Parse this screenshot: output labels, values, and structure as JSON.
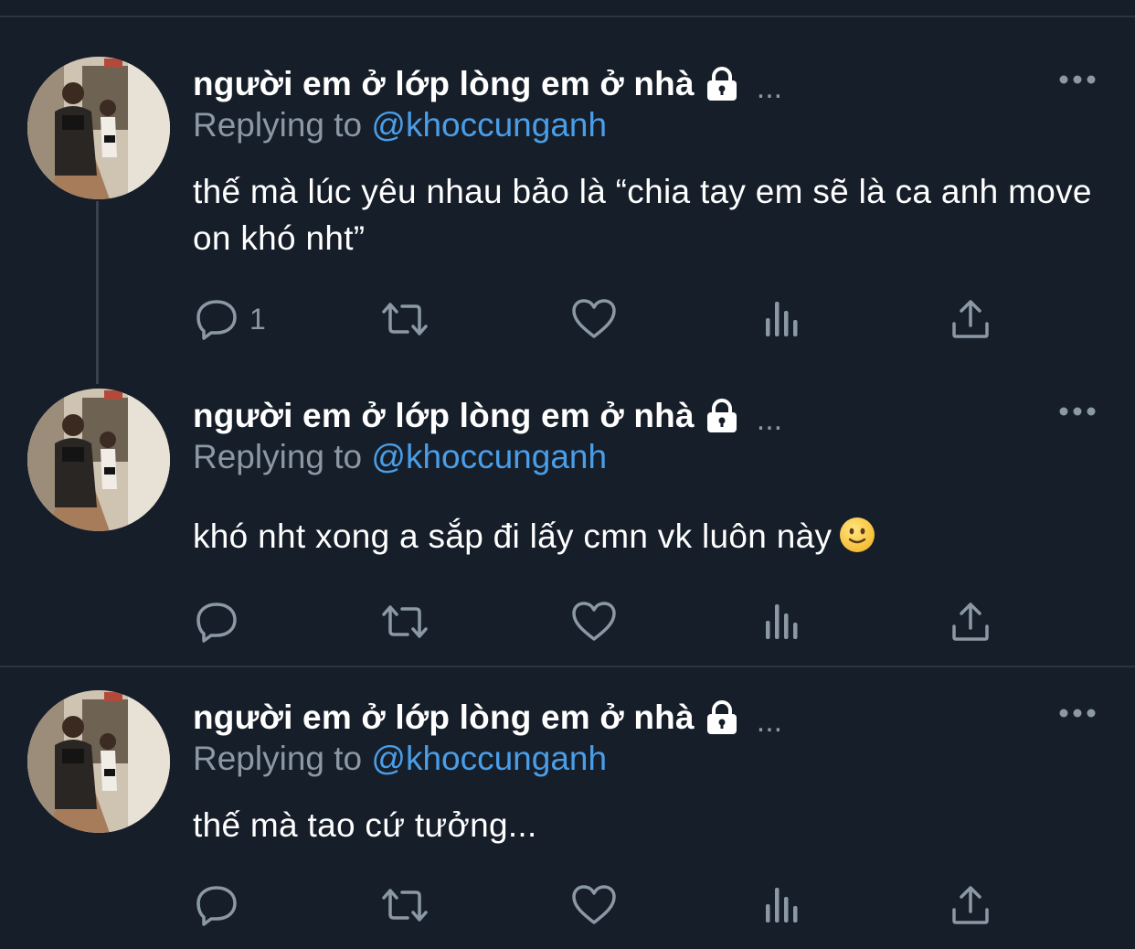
{
  "colors": {
    "background": "#161e29",
    "divider": "#2b3440",
    "muted": "#8b98a5",
    "link": "#4a9ee8",
    "text": "#ffffff"
  },
  "tweets": [
    {
      "display_name": "người em ở lớp lòng em ở nhà",
      "truncation": "...",
      "reply_prefix": "Replying to",
      "reply_handle": "@khoccunganh",
      "text": "thế mà lúc yêu nhau bảo là “chia tay em sẽ là ca anh move on khó nht”",
      "reply_count": "1",
      "icons": [
        "reply-icon",
        "retweet-icon",
        "like-icon",
        "analytics-icon",
        "share-icon"
      ]
    },
    {
      "display_name": "người em ở lớp lòng em ở nhà",
      "truncation": "...",
      "reply_prefix": "Replying to",
      "reply_handle": "@khoccunganh",
      "text": "khó nht xong a sắp đi lấy cmn vk luôn này",
      "emoji": "slightly-smiling-face-emoji",
      "reply_count": "",
      "icons": [
        "reply-icon",
        "retweet-icon",
        "like-icon",
        "analytics-icon",
        "share-icon"
      ]
    },
    {
      "display_name": "người em ở lớp lòng em ở nhà",
      "truncation": "...",
      "reply_prefix": "Replying to",
      "reply_handle": "@khoccunganh",
      "text": "thế mà tao cứ tưởng...",
      "reply_count": "",
      "icons": [
        "reply-icon",
        "retweet-icon",
        "like-icon",
        "analytics-icon",
        "share-icon"
      ]
    }
  ]
}
